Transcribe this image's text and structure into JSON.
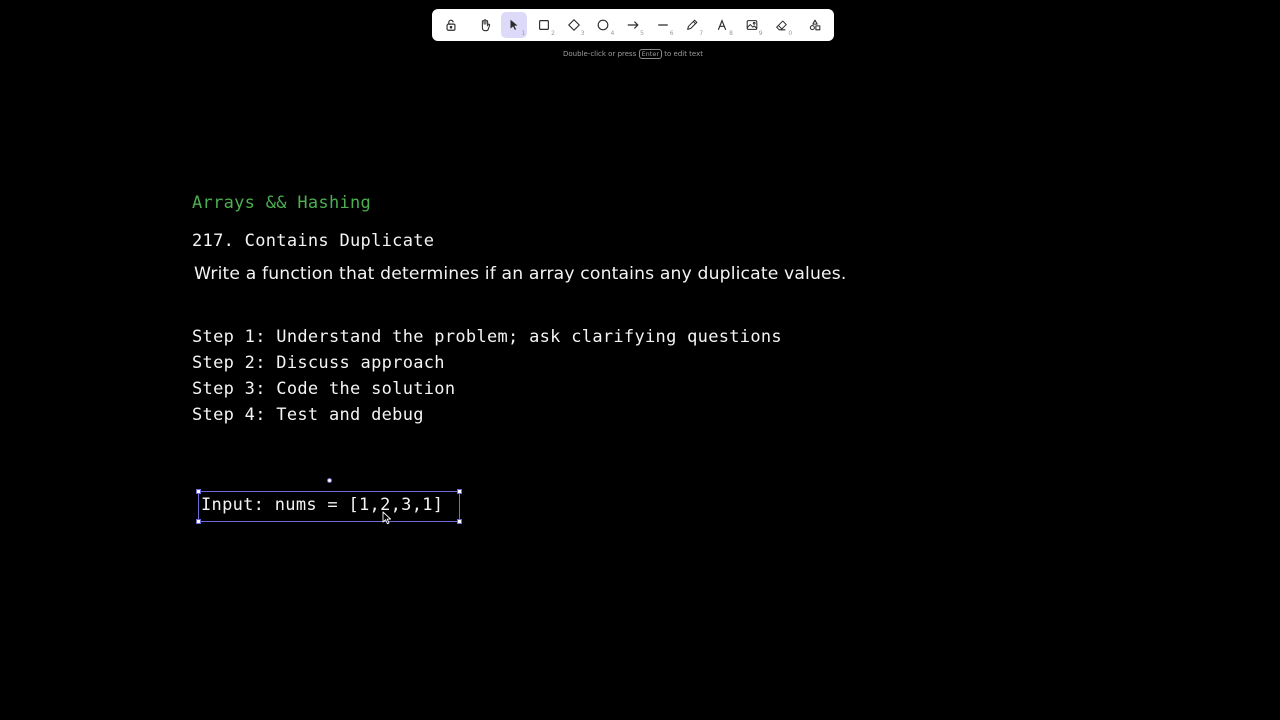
{
  "toolbar": {
    "tools": [
      {
        "name": "lock",
        "key": ""
      },
      {
        "name": "hand",
        "key": ""
      },
      {
        "name": "selection",
        "key": "1",
        "selected": true
      },
      {
        "name": "rectangle",
        "key": "2"
      },
      {
        "name": "diamond",
        "key": "3"
      },
      {
        "name": "ellipse",
        "key": "4"
      },
      {
        "name": "arrow",
        "key": "5"
      },
      {
        "name": "line",
        "key": "6"
      },
      {
        "name": "draw",
        "key": "7"
      },
      {
        "name": "text",
        "key": "8"
      },
      {
        "name": "image",
        "key": "9"
      },
      {
        "name": "eraser",
        "key": "0"
      },
      {
        "name": "more-tools",
        "key": ""
      }
    ]
  },
  "hint": {
    "before": "Double-click or press",
    "key": "Enter",
    "after": "to edit text"
  },
  "canvas": {
    "section_title": "Arrays && Hashing",
    "problem_title": "217. Contains Duplicate",
    "description": "Write a function that determines if an array contains any duplicate values.",
    "steps": [
      "Step 1: Understand the problem; ask clarifying questions",
      "Step 2: Discuss approach",
      "Step 3: Code the solution",
      "Step 4: Test and debug"
    ],
    "selected_text": "Input: nums = [1,2,3,1]"
  },
  "colors": {
    "background": "#000000",
    "section_title": "#4caf50",
    "text": "#f4f4f4",
    "selection": "#6f6ad9",
    "tool_selected": "#dcdaf8"
  }
}
